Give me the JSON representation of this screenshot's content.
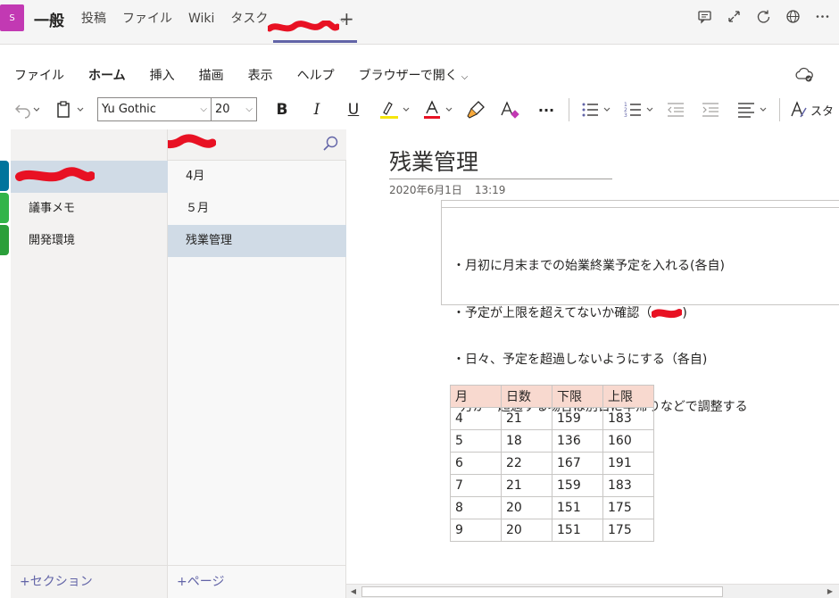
{
  "teams": {
    "avatar_letter": "S",
    "channel": "一般",
    "tabs": [
      "投稿",
      "ファイル",
      "Wiki",
      "タスク"
    ],
    "add_tab": "+"
  },
  "ribbon": {
    "tabs": [
      "ファイル",
      "ホーム",
      "挿入",
      "描画",
      "表示",
      "ヘルプ",
      "ブラウザーで開く"
    ],
    "active_tab": "ホーム",
    "font_name": "Yu Gothic",
    "font_size": "20",
    "bold": "B",
    "italic": "I",
    "underline": "U",
    "more": "···",
    "style_label": "スタ",
    "highlight_color": "#f5e50b",
    "font_color": "#e81123"
  },
  "sections": {
    "items": [
      "",
      "議事メモ",
      "開発環境"
    ],
    "add_label": "+セクション",
    "tab_colors": [
      "#00749c",
      "#32b449",
      "#2b9f3a"
    ]
  },
  "pages": {
    "items": [
      "4月",
      "５月",
      "残業管理"
    ],
    "add_label": "+ページ"
  },
  "note": {
    "title": "残業管理",
    "date": "2020年6月1日",
    "time": "13:19",
    "lines": [
      "・月初に月末までの始業終業予定を入れる(各自)",
      "・予定が上限を超えてないか確認（",
      "・日々、予定を超過しないようにする（各自)",
      "  万が一超過する場合は別日に早帰りなどで調整する"
    ],
    "line2_suffix": ")"
  },
  "table": {
    "headers": [
      "月",
      "日数",
      "下限",
      "上限"
    ],
    "rows": [
      [
        "4",
        "21",
        "159",
        "183"
      ],
      [
        "5",
        "18",
        "136",
        "160"
      ],
      [
        "6",
        "22",
        "167",
        "191"
      ],
      [
        "7",
        "21",
        "159",
        "183"
      ],
      [
        "8",
        "20",
        "151",
        "175"
      ],
      [
        "9",
        "20",
        "151",
        "175"
      ]
    ]
  },
  "colors": {
    "accent": "#6264a7",
    "redaction": "#e81123",
    "selected": "#d0dbe6",
    "table_header": "#f8d9cf"
  }
}
